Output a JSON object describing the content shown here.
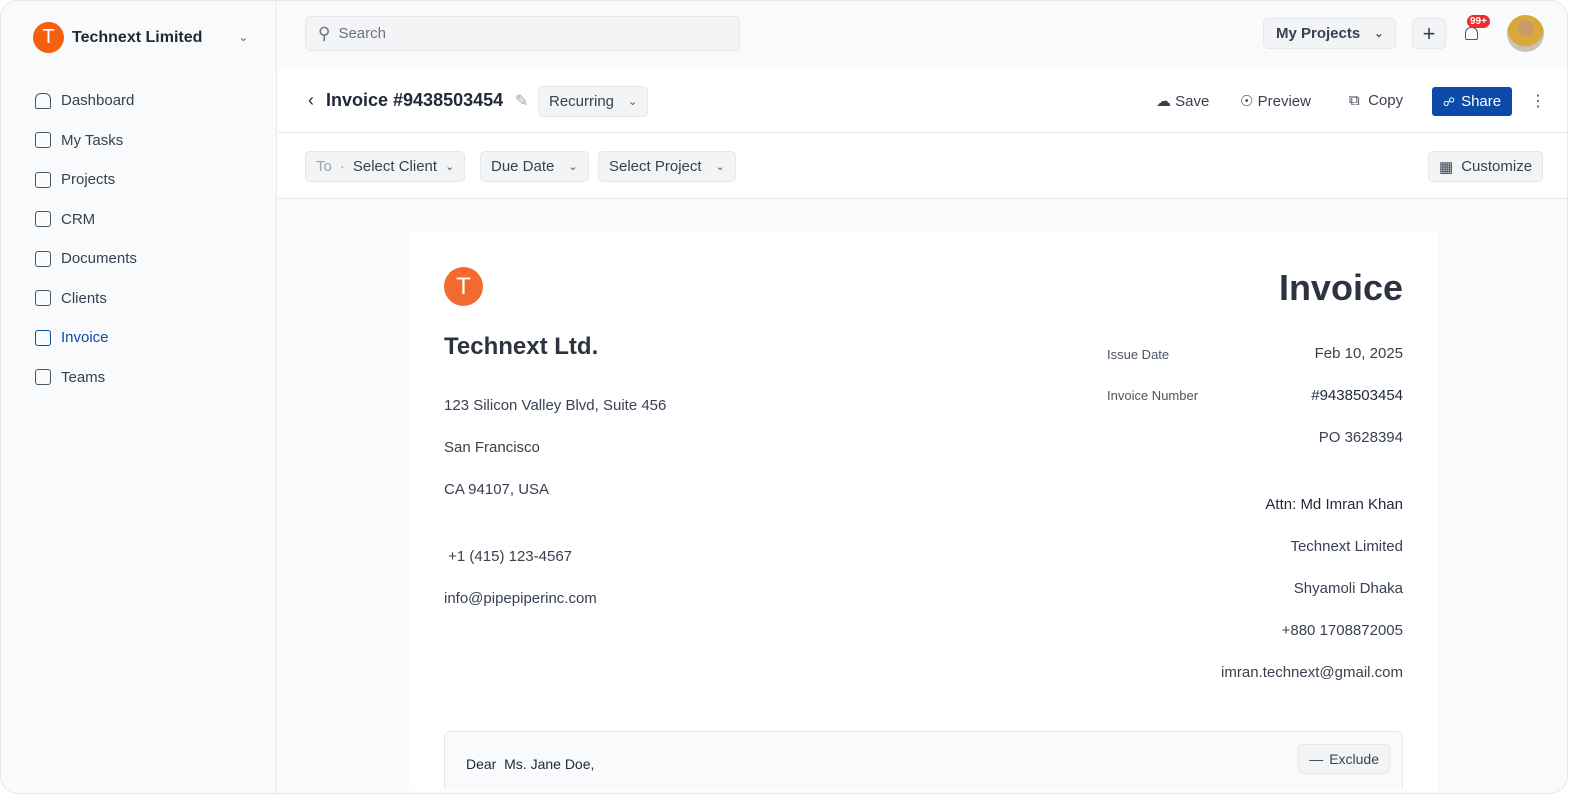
{
  "sidebar": {
    "org": "Technext Limited",
    "logo_letter": "T",
    "items": [
      {
        "label": "Dashboard"
      },
      {
        "label": "My Tasks"
      },
      {
        "label": "Projects"
      },
      {
        "label": "CRM"
      },
      {
        "label": "Documents"
      },
      {
        "label": "Clients"
      },
      {
        "label": "Invoice",
        "active": true
      },
      {
        "label": "Teams"
      }
    ]
  },
  "header": {
    "search_placeholder": "Search",
    "projects_label": "My Projects",
    "notif_badge": "99+"
  },
  "titlebar": {
    "title": "Invoice #9438503454",
    "status": "Recurring",
    "save": "Save",
    "preview": "Preview",
    "copy": "Copy",
    "share": "Share"
  },
  "filters": {
    "to": "To",
    "client": "Select Client",
    "due": "Due Date",
    "project": "Select Project",
    "customize": "Customize"
  },
  "invoice": {
    "logo_letter": "T",
    "heading": "Invoice",
    "company": "Technext Ltd.",
    "address1": "123 Silicon Valley Blvd, Suite 456",
    "city": "San Francisco",
    "state": "CA 94107, USA",
    "phone": " +1 (415) 123-4567",
    "email": "info@pipepiperinc.com",
    "issue_label": "Issue Date",
    "issue_date": "Feb 10, 2025",
    "number_label": "Invoice Number",
    "number": "#9438503454",
    "po": "PO 3628394",
    "attn": "Attn: Md Imran Khan",
    "client_company": "Technext Limited",
    "client_address": "Shyamoli Dhaka",
    "client_phone": "+880 1708872005",
    "client_email": "imran.technext@gmail.com",
    "greeting": "Dear  Ms. Jane Doe,",
    "exclude": "Exclude"
  },
  "colors": {
    "accent": "#0b4aa8",
    "brand": "#f3600f",
    "badge": "#ef2b2b"
  }
}
